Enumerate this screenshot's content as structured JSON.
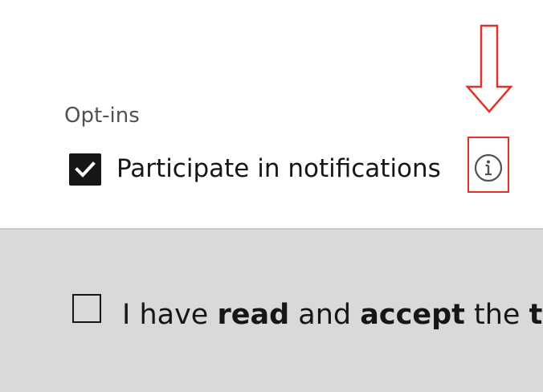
{
  "optins": {
    "label": "Opt-ins",
    "notification_checkbox": {
      "label": "Participate in notifications",
      "checked": true,
      "info_icon": "info-circle-icon"
    }
  },
  "terms": {
    "checked": false,
    "part1": "I have ",
    "bold1": "read",
    "part2": " and ",
    "bold2": "accept",
    "part3": " the ",
    "bold3": "te"
  },
  "annotation": {
    "arrow_color": "#e0322b",
    "highlight_color": "#e0322b"
  }
}
